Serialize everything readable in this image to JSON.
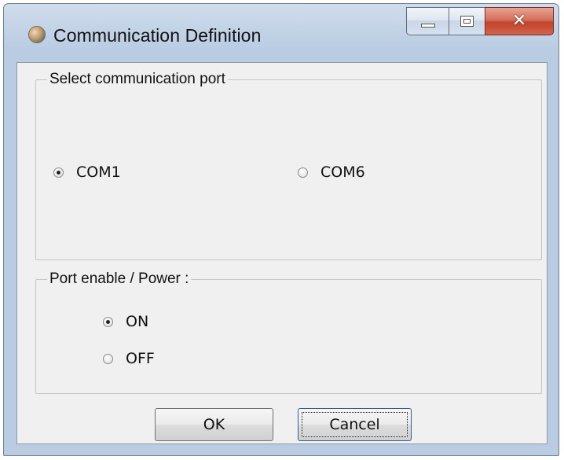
{
  "window": {
    "title": "Communication Definition",
    "close_glyph": "✕"
  },
  "port_group": {
    "legend": "Select communication port",
    "options": [
      {
        "label": "COM1",
        "checked": true
      },
      {
        "label": "COM6",
        "checked": false
      }
    ]
  },
  "power_group": {
    "legend": "Port enable / Power :",
    "options": [
      {
        "label": "ON",
        "checked": true
      },
      {
        "label": "OFF",
        "checked": false
      }
    ]
  },
  "buttons": {
    "ok": "OK",
    "cancel": "Cancel"
  },
  "icons": [
    "app-globe-icon",
    "minimize-icon",
    "maximize-icon",
    "close-icon"
  ]
}
